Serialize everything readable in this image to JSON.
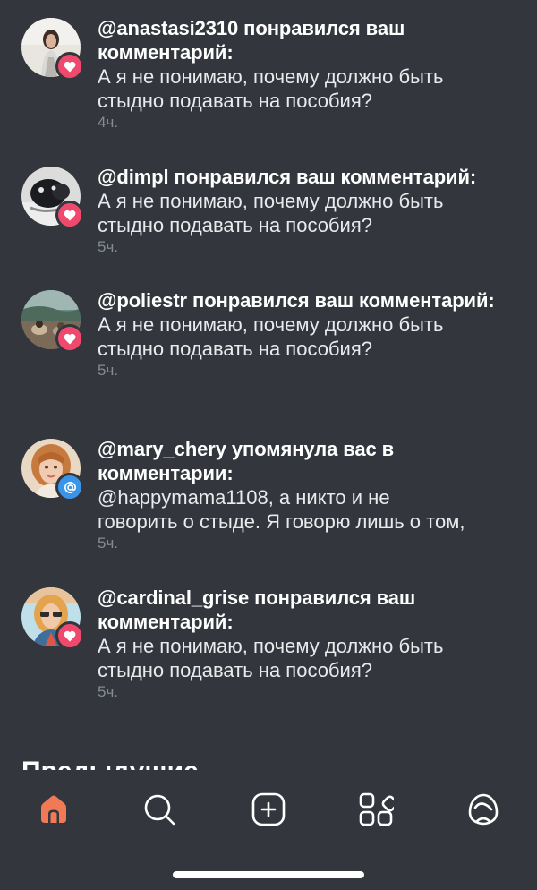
{
  "notifications": [
    {
      "username": "@anastasi2310",
      "action": "понравился ваш комментарий:",
      "comment": "А я не понимаю, почему должно быть\nстыдно подавать на пособия?",
      "time": "4ч.",
      "badge": "heart-icon"
    },
    {
      "username": "@dimpl",
      "action": "понравился ваш комментарий:",
      "comment": "А я не понимаю, почему должно быть\nстыдно подавать на пособия?",
      "time": "5ч.",
      "badge": "heart-icon"
    },
    {
      "username": "@poliestr",
      "action": "понравился ваш комментарий:",
      "comment": "А я не понимаю, почему должно быть\nстыдно подавать на пособия?",
      "time": "5ч.",
      "badge": "heart-icon"
    },
    {
      "username": "@mary_chery",
      "action": "упомянула вас в комментарии:",
      "comment": "@happymama1108, а никто и не\nговорить о стыде. Я говорю лишь о том,",
      "time": "5ч.",
      "badge": "at-icon"
    },
    {
      "username": "@cardinal_grise",
      "action": "понравился ваш комментарий:",
      "comment": "А я не понимаю, почему должно быть\nстыдно подавать на пособия?",
      "time": "5ч.",
      "badge": "heart-icon"
    }
  ],
  "section_title": "Предыдущие",
  "tabbar": {
    "items": [
      "home-icon",
      "search-icon",
      "add-icon",
      "apps-icon",
      "profile-icon"
    ],
    "active": "home-icon"
  },
  "colors": {
    "background": "#33373d",
    "like_badge": "#ef4a6e",
    "mention_badge": "#3a94e8",
    "active_tab": "#f07a55",
    "timestamp": "#868b92"
  }
}
